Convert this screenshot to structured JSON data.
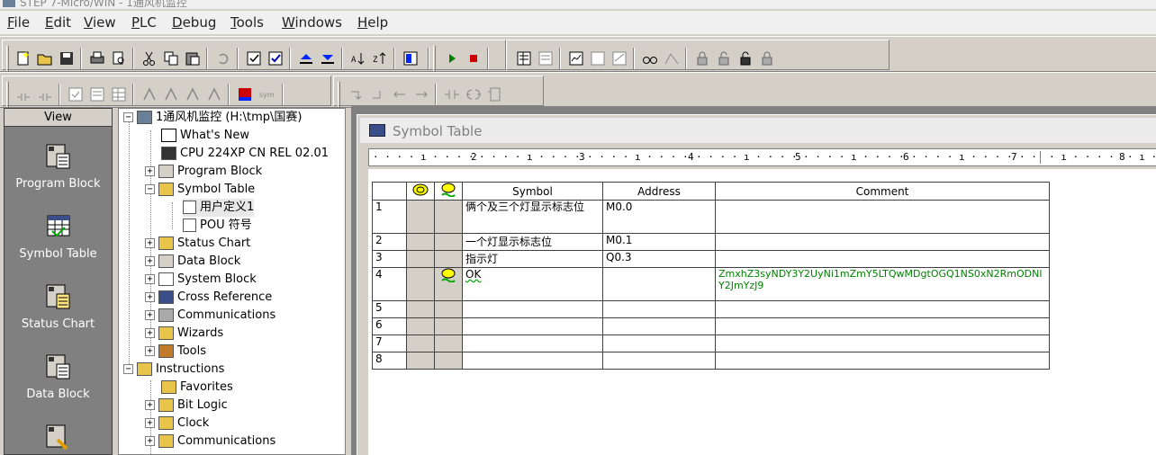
{
  "window": {
    "title": "STEP 7-Micro/WIN - 1通风机监控"
  },
  "menu": [
    "File",
    "Edit",
    "View",
    "PLC",
    "Debug",
    "Tools",
    "Windows",
    "Help"
  ],
  "viewbar": {
    "header": "View",
    "items": [
      "Program Block",
      "Symbol Table",
      "Status Chart",
      "Data Block"
    ]
  },
  "tree": {
    "project": "1通风机监控 (H:\\tmp\\国赛)",
    "nodes": [
      "What's New",
      "CPU 224XP CN REL 02.01",
      "Program Block",
      "Symbol Table",
      "用户定义1",
      "POU 符号",
      "Status Chart",
      "Data Block",
      "System Block",
      "Cross Reference",
      "Communications",
      "Wizards",
      "Tools",
      "Instructions",
      "Favorites",
      "Bit Logic",
      "Clock",
      "Communications"
    ]
  },
  "symbol_table": {
    "title": "Symbol Table",
    "ruler": [
      "2",
      "3",
      "4",
      "5",
      "6",
      "7",
      "8"
    ],
    "columns": {
      "symbol": "Symbol",
      "address": "Address",
      "comment": "Comment"
    },
    "rows": [
      {
        "num": "1",
        "symbol": "俩个及三个灯显示标志位",
        "address": "M0.0",
        "comment": "",
        "flag": false
      },
      {
        "num": "2",
        "symbol": "一个灯显示标志位",
        "address": "M0.1",
        "comment": "",
        "flag": false
      },
      {
        "num": "3",
        "symbol": "指示灯",
        "address": "Q0.3",
        "comment": "",
        "flag": false
      },
      {
        "num": "4",
        "symbol": "OK",
        "address": "",
        "comment": "ZmxhZ3syNDY3Y2UyNi1mZmY5LTQwMDgtOGQ1NS0xN2RmODNlY2JmYzJ9",
        "flag": true
      },
      {
        "num": "5",
        "symbol": "",
        "address": "",
        "comment": "",
        "flag": false
      },
      {
        "num": "6",
        "symbol": "",
        "address": "",
        "comment": "",
        "flag": false
      },
      {
        "num": "7",
        "symbol": "",
        "address": "",
        "comment": "",
        "flag": false
      },
      {
        "num": "8",
        "symbol": "",
        "address": "",
        "comment": "",
        "flag": false
      }
    ]
  },
  "colors": {
    "accent_green": "#008000",
    "chrome": "#d4d0c8"
  }
}
